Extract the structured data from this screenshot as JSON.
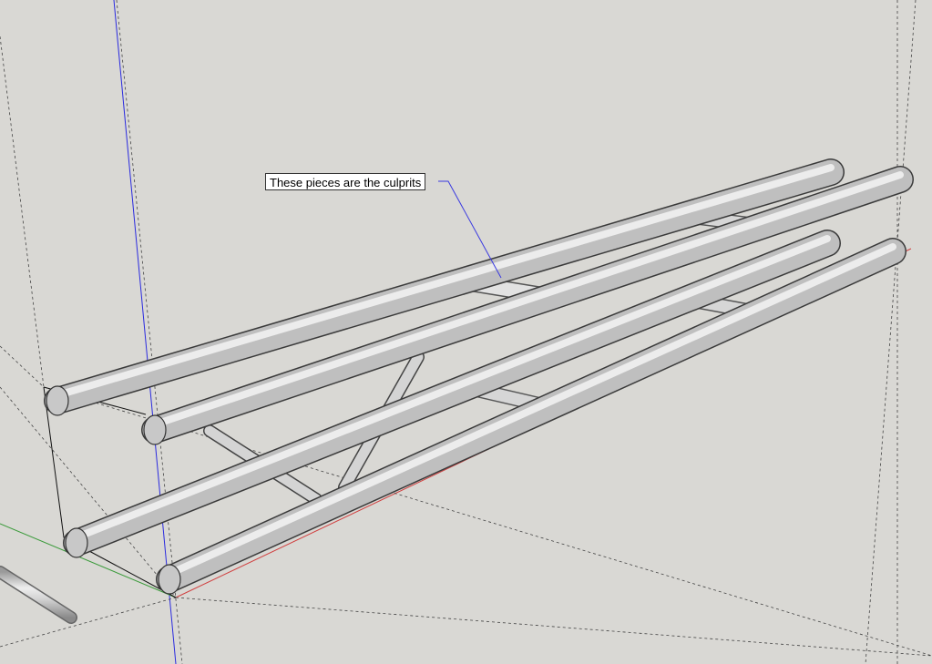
{
  "app": "SketchUp",
  "viewport": {
    "background": "#d9d8d4",
    "axes": {
      "red": "#d04040",
      "green": "#3a9a3a",
      "blue": "#2a2adf"
    }
  },
  "model": {
    "description_icon": "truss-model-icon",
    "tube_color": "#c9c9c9",
    "edge_color": "#3a3a3a"
  },
  "annotation": {
    "text": "These pieces are the culprits",
    "leader_color": "#3a3ae0"
  }
}
